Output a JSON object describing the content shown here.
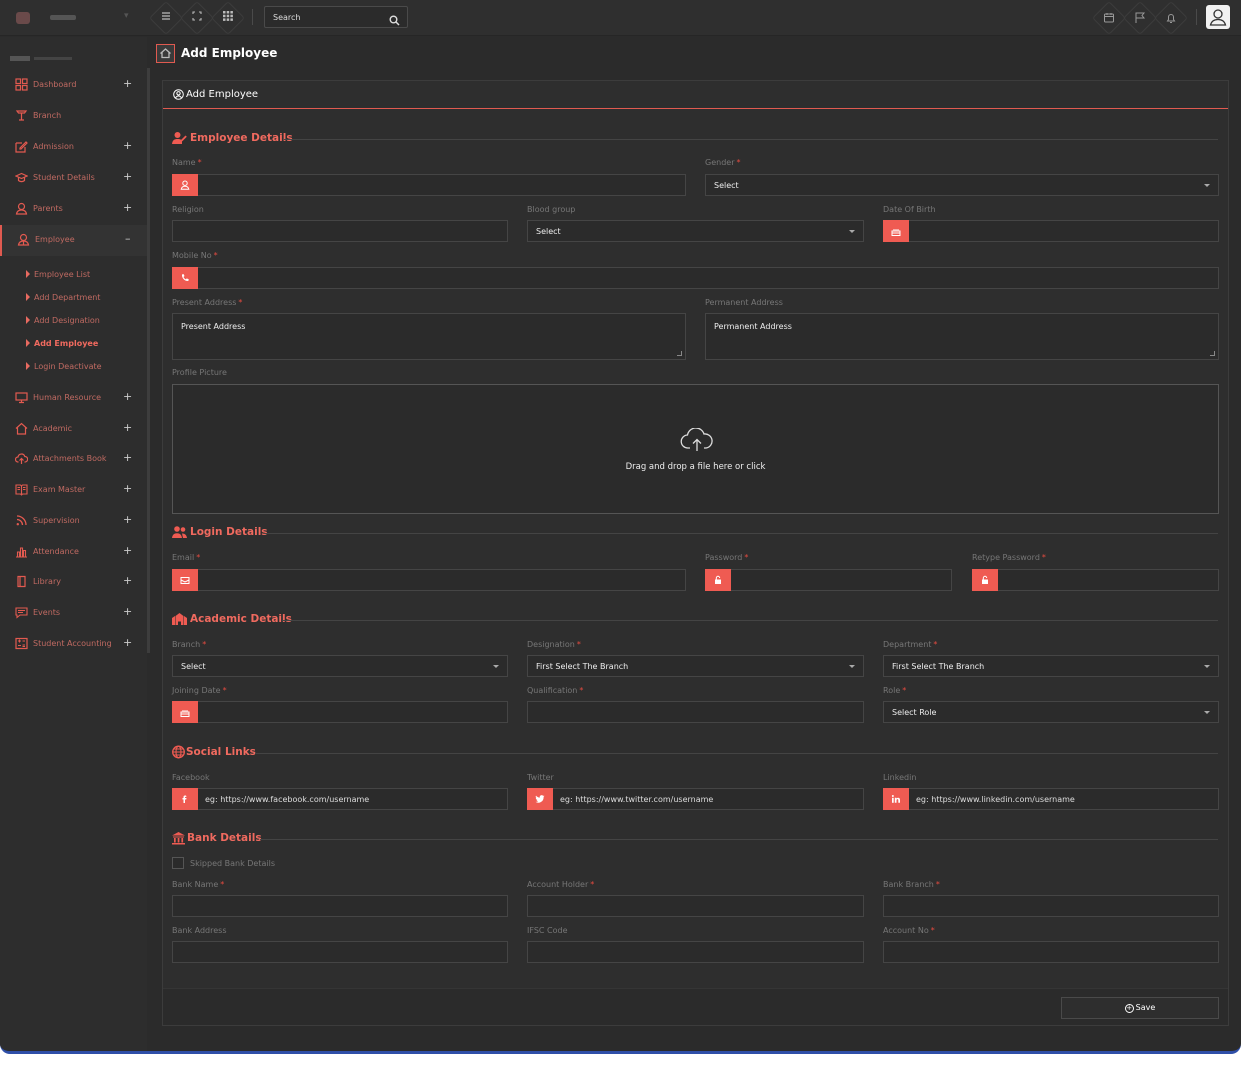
{
  "topbar": {
    "search_placeholder": "Search"
  },
  "sidebar": {
    "items": [
      {
        "label": "Dashboard",
        "icon": "dashboard-icon",
        "expandable": true
      },
      {
        "label": "Branch",
        "icon": "branch-icon",
        "expandable": false
      },
      {
        "label": "Admission",
        "icon": "admission-icon",
        "expandable": true
      },
      {
        "label": "Student Details",
        "icon": "graduation-cap-icon",
        "expandable": true
      },
      {
        "label": "Parents",
        "icon": "user-icon",
        "expandable": true
      },
      {
        "label": "Employee",
        "icon": "employee-icon",
        "expandable": true,
        "expanded": true
      },
      {
        "label": "Human Resource",
        "icon": "monitor-icon",
        "expandable": true
      },
      {
        "label": "Academic",
        "icon": "home-icon",
        "expandable": true
      },
      {
        "label": "Attachments Book",
        "icon": "cloud-upload-icon",
        "expandable": true
      },
      {
        "label": "Exam Master",
        "icon": "book-icon",
        "expandable": true
      },
      {
        "label": "Supervision",
        "icon": "rss-icon",
        "expandable": true
      },
      {
        "label": "Attendance",
        "icon": "bar-chart-icon",
        "expandable": true
      },
      {
        "label": "Library",
        "icon": "library-icon",
        "expandable": true
      },
      {
        "label": "Events",
        "icon": "message-icon",
        "expandable": true
      },
      {
        "label": "Student Accounting",
        "icon": "accounting-icon",
        "expandable": true
      }
    ],
    "employee_sub": [
      {
        "label": "Employee List"
      },
      {
        "label": "Add Department"
      },
      {
        "label": "Add Designation"
      },
      {
        "label": "Add Employee",
        "current": true
      },
      {
        "label": "Login Deactivate"
      }
    ],
    "plus": "+",
    "minus": "–"
  },
  "page": {
    "title": "Add Employee",
    "card_title": "Add Employee"
  },
  "sections": {
    "employee": "Employee Details",
    "login": "Login Details",
    "academic": "Academic Details",
    "social": "Social Links",
    "bank": "Bank Details"
  },
  "fields": {
    "name": "Name",
    "gender": "Gender",
    "gender_value": "Select",
    "religion": "Religion",
    "blood_group": "Blood group",
    "blood_group_value": "Select",
    "dob": "Date Of Birth",
    "mobile": "Mobile No",
    "present_address": "Present Address",
    "present_address_ph": "Present Address",
    "permanent_address": "Permanent Address",
    "permanent_address_ph": "Permanent Address",
    "profile_picture": "Profile Picture",
    "drop_text": "Drag and drop a file here or click",
    "email": "Email",
    "password": "Password",
    "retype_password": "Retype Password",
    "branch": "Branch",
    "branch_value": "Select",
    "designation": "Designation",
    "designation_value": "First Select The Branch",
    "department": "Department",
    "department_value": "First Select The Branch",
    "joining_date": "Joining Date",
    "qualification": "Qualification",
    "role": "Role",
    "role_value": "Select Role",
    "facebook": "Facebook",
    "facebook_ph": "eg: https://www.facebook.com/username",
    "twitter": "Twitter",
    "twitter_ph": "eg: https://www.twitter.com/username",
    "linkedin": "Linkedin",
    "linkedin_ph": "eg: https://www.linkedin.com/username",
    "skip_bank": "Skipped Bank Details",
    "bank_name": "Bank Name",
    "account_holder": "Account Holder",
    "bank_branch": "Bank Branch",
    "bank_address": "Bank Address",
    "ifsc": "IFSC Code",
    "account_no": "Account No",
    "required_mark": "*"
  },
  "footer": {
    "save_label": "Save"
  },
  "colors": {
    "accent": "#ef5b52",
    "background": "#2b2b2b",
    "sidebar_text": "#c06a62"
  }
}
